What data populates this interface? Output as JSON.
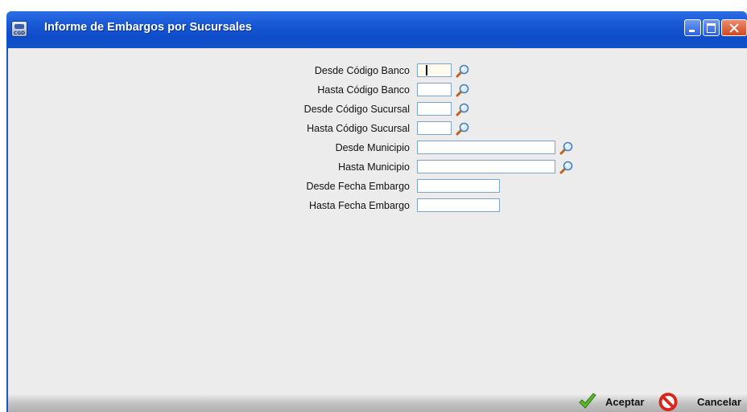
{
  "window": {
    "title": "Informe de Embargos por Sucursales",
    "icon_text": "CGD"
  },
  "form": {
    "desde_codigo_banco": {
      "label": "Desde Código Banco",
      "value": ""
    },
    "hasta_codigo_banco": {
      "label": "Hasta Código Banco",
      "value": ""
    },
    "desde_codigo_sucursal": {
      "label": "Desde Código Sucursal",
      "value": ""
    },
    "hasta_codigo_sucursal": {
      "label": "Hasta Código Sucursal",
      "value": ""
    },
    "desde_municipio": {
      "label": "Desde Municipio",
      "value": ""
    },
    "hasta_municipio": {
      "label": "Hasta Municipio",
      "value": ""
    },
    "desde_fecha_embargo": {
      "label": "Desde Fecha Embargo",
      "value": ""
    },
    "hasta_fecha_embargo": {
      "label": "Hasta Fecha Embargo",
      "value": ""
    }
  },
  "footer": {
    "aceptar_label": "Aceptar",
    "cancelar_label": "Cancelar"
  },
  "colors": {
    "titlebar": "#0e4cc9",
    "content_bg": "#ececec",
    "field_border": "#7fa3c8",
    "focused_field_bg": "#fffaee",
    "accept_green": "#5cb82a",
    "cancel_red": "#d8261a"
  },
  "icons": {
    "lookup": "magnifier-icon",
    "accept": "checkmark-icon",
    "cancel": "no-entry-icon"
  }
}
